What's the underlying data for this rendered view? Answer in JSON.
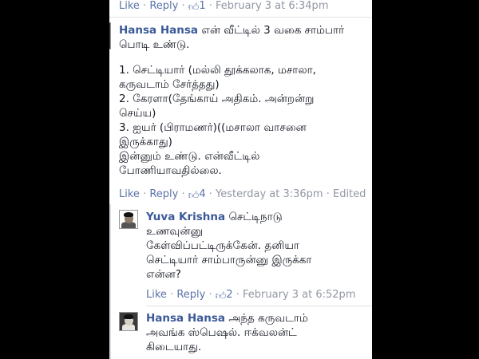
{
  "top_meta": {
    "like": "Like",
    "reply": "Reply",
    "likes": "1",
    "timestamp": "February 3 at 6:34pm"
  },
  "comment1": {
    "author": "Hansa Hansa",
    "lines": [
      "என் வீட்டில் 3 வகை சாம்பார்",
      "பொடி உண்டு.",
      "",
      "1. செட்டியார் (மல்லி தூக்கலாக, மசாலா,",
      "கருவடாம் சேர்த்தது)",
      "2. கேரளா(தேங்காய் அதிகம். அன்றன்று",
      "செய்ய)",
      "3. ஐயர் (பிராமணர்)((மசாலா வாசனை",
      "இருக்காது)",
      "இன்னும் உண்டு. என்வீட்டில்",
      "போணியாவதில்லை."
    ],
    "like": "Like",
    "reply": "Reply",
    "likes": "4",
    "timestamp": "Yesterday at 3:36pm",
    "edited": "Edited"
  },
  "reply1": {
    "author": "Yuva Krishna",
    "lines": [
      "செட்டிநாடு",
      "உணவுன்னு",
      "கேள்விப்பட்டிருக்கேன். தனியா",
      "செட்டியார் சாம்பாருன்னு இருக்கா",
      "என்ன?"
    ],
    "like": "Like",
    "reply": "Reply",
    "likes": "2",
    "timestamp": "February 3 at 6:52pm"
  },
  "reply2": {
    "author": "Hansa Hansa",
    "lines": [
      "அந்த கருவடாம்",
      "அவங்க ஸ்பெஷல். ஈக்வலன்ட்",
      "கிடையாது."
    ]
  },
  "colors": {
    "link": "#3b5998",
    "meta": "#9197a3",
    "text": "#141823",
    "background": "#000000"
  },
  "icons": {
    "like_thumb": "thumbs-up-icon"
  }
}
